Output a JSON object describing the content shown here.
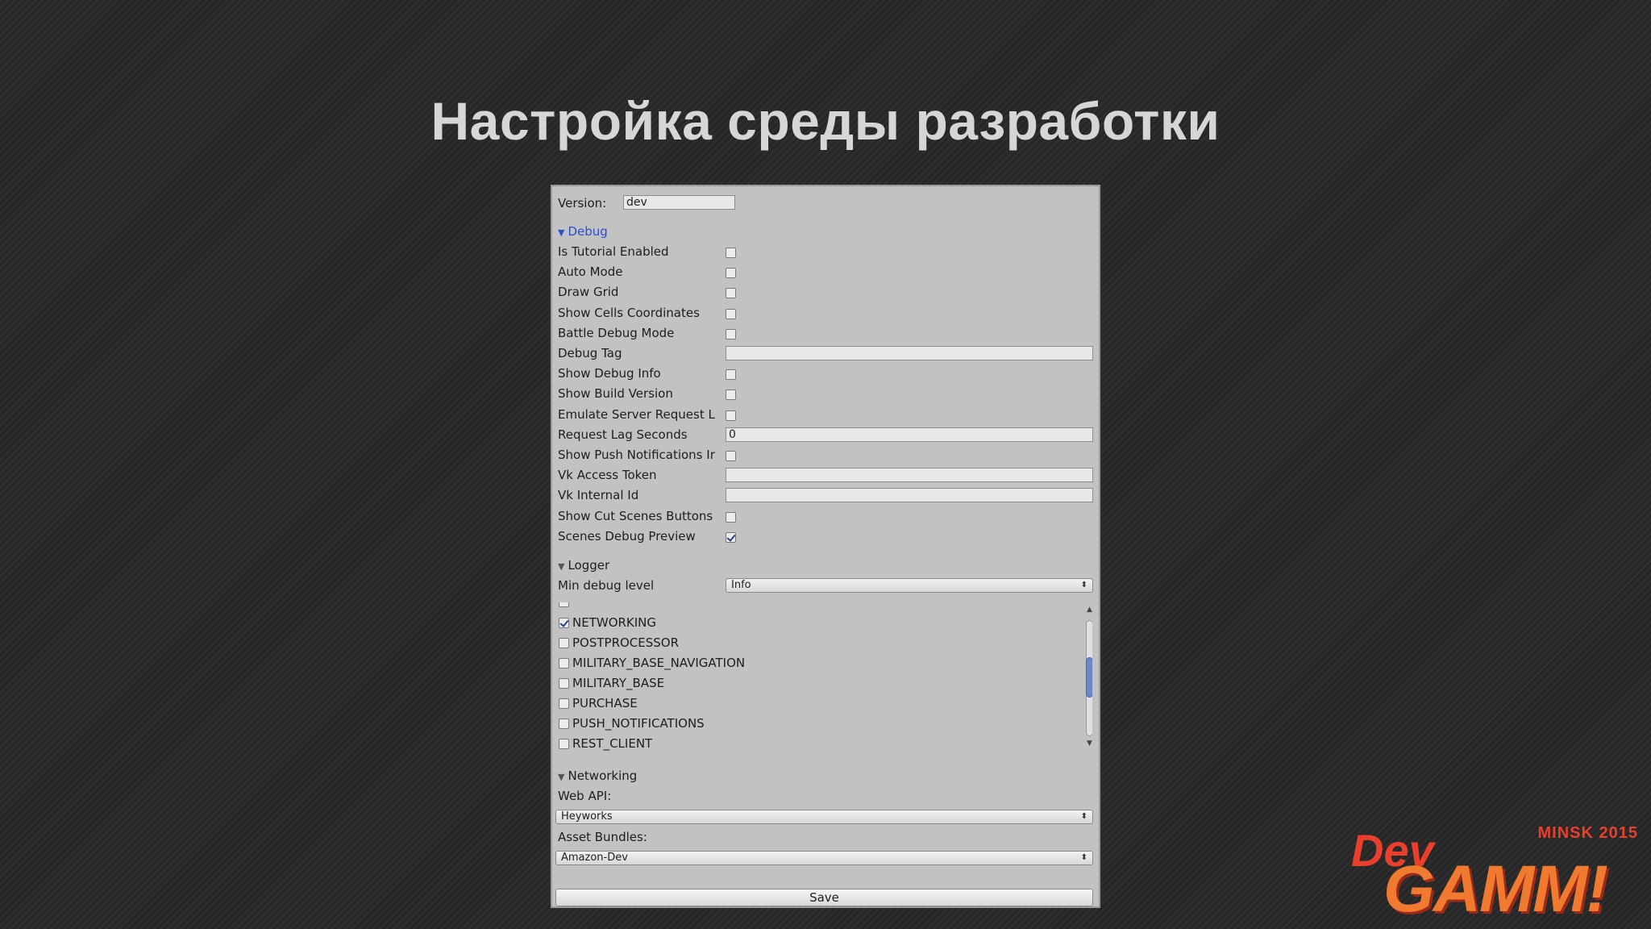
{
  "slide": {
    "title": "Настройка среды разработки"
  },
  "version": {
    "label": "Version:",
    "value": "dev"
  },
  "debug": {
    "header": "Debug",
    "fields": [
      {
        "label": "Is Tutorial Enabled",
        "kind": "checkbox",
        "checked": false
      },
      {
        "label": "Auto Mode",
        "kind": "checkbox",
        "checked": false
      },
      {
        "label": "Draw Grid",
        "kind": "checkbox",
        "checked": false
      },
      {
        "label": "Show Cells Coordinates",
        "kind": "checkbox",
        "checked": false
      },
      {
        "label": "Battle Debug Mode",
        "kind": "checkbox",
        "checked": false
      },
      {
        "label": "Debug Tag",
        "kind": "text",
        "value": ""
      },
      {
        "label": "Show Debug Info",
        "kind": "checkbox",
        "checked": false
      },
      {
        "label": "Show Build Version",
        "kind": "checkbox",
        "checked": false
      },
      {
        "label": "Emulate Server Request L",
        "kind": "checkbox",
        "checked": false
      },
      {
        "label": "Request Lag Seconds",
        "kind": "text",
        "value": "0"
      },
      {
        "label": "Show Push Notifications Ir",
        "kind": "checkbox",
        "checked": false
      },
      {
        "label": "Vk Access Token",
        "kind": "text",
        "value": ""
      },
      {
        "label": "Vk Internal Id",
        "kind": "text",
        "value": ""
      },
      {
        "label": "Show Cut Scenes Buttons",
        "kind": "checkbox",
        "checked": false
      },
      {
        "label": "Scenes Debug Preview",
        "kind": "checkbox",
        "checked": true
      }
    ]
  },
  "logger": {
    "header": "Logger",
    "min_level_label": "Min debug level",
    "min_level_value": "Info",
    "channels": [
      {
        "label": "NETWORKING",
        "checked": true
      },
      {
        "label": "POSTPROCESSOR",
        "checked": false
      },
      {
        "label": "MILITARY_BASE_NAVIGATION",
        "checked": false
      },
      {
        "label": "MILITARY_BASE",
        "checked": false
      },
      {
        "label": "PURCHASE",
        "checked": false
      },
      {
        "label": "PUSH_NOTIFICATIONS",
        "checked": false
      },
      {
        "label": "REST_CLIENT",
        "checked": false
      }
    ]
  },
  "networking": {
    "header": "Networking",
    "web_api_label": "Web API:",
    "web_api_value": "Heyworks",
    "asset_bundles_label": "Asset Bundles:",
    "asset_bundles_value": "Amazon-Dev"
  },
  "save_label": "Save",
  "logo": {
    "city": "MINSK 2015",
    "dev": "Dev",
    "gamm": "GAMM!"
  },
  "colors": {
    "foldout_active": "#2c4fd1",
    "panel_bg": "#c2c2c2",
    "logo_red": "#e8402c",
    "logo_orange": "#f07a30"
  }
}
